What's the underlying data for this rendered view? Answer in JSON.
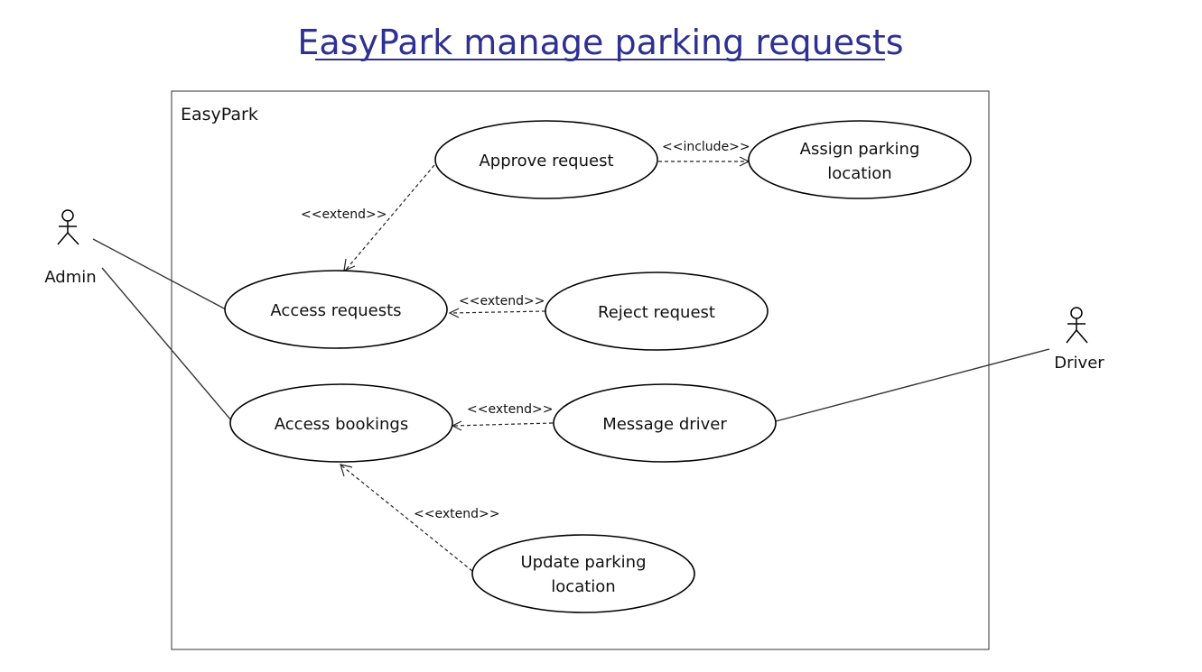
{
  "title": "EasyPark manage parking requests",
  "system_boundary": {
    "label": "EasyPark"
  },
  "actors": {
    "admin": "Admin",
    "driver": "Driver"
  },
  "use_cases": {
    "approve_request": [
      "Approve request"
    ],
    "assign_parking_location": [
      "Assign parking",
      "location"
    ],
    "access_requests": [
      "Access requests"
    ],
    "reject_request": [
      "Reject request"
    ],
    "access_bookings": [
      "Access bookings"
    ],
    "message_driver": [
      "Message driver"
    ],
    "update_parking_location": [
      "Update parking",
      "location"
    ]
  },
  "relationships": {
    "approve_extends_access_requests": "<<extend>>",
    "approve_includes_assign": "<<include>>",
    "reject_extends_access_requests": "<<extend>>",
    "message_extends_access_bookings": "<<extend>>",
    "update_extends_access_bookings": "<<extend>>"
  },
  "colors": {
    "title": "#2e3192",
    "lines": "#333333"
  }
}
